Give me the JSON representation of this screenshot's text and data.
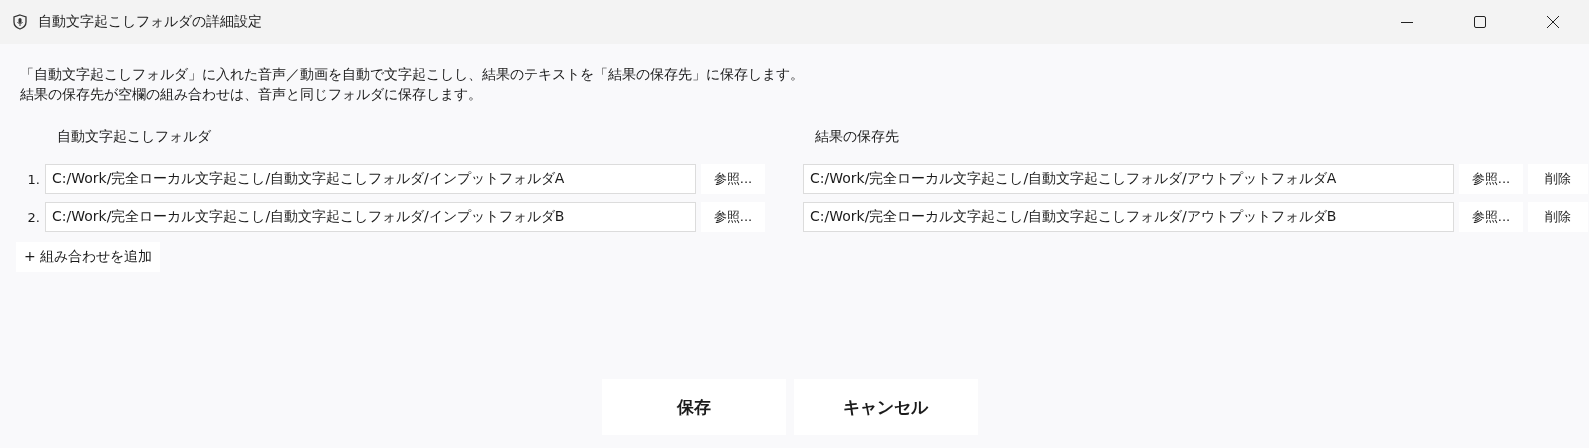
{
  "window": {
    "title": "自動文字起こしフォルダの詳細設定"
  },
  "description": [
    "「自動文字起こしフォルダ」に入れた音声／動画を自動で文字起こしし、結果のテキストを「結果の保存先」に保存します。",
    "結果の保存先が空欄の組み合わせは、音声と同じフォルダに保存します。"
  ],
  "columns": {
    "input": "自動文字起こしフォルダ",
    "output": "結果の保存先"
  },
  "rows": [
    {
      "number": "1.",
      "input": "C:/Work/完全ローカル文字起こし/自動文字起こしフォルダ/インプットフォルダA",
      "input_browse": "参照...",
      "output": "C:/Work/完全ローカル文字起こし/自動文字起こしフォルダ/アウトプットフォルダA",
      "output_browse": "参照...",
      "delete": "削除"
    },
    {
      "number": "2.",
      "input": "C:/Work/完全ローカル文字起こし/自動文字起こしフォルダ/インプットフォルダB",
      "input_browse": "参照...",
      "output": "C:/Work/完全ローカル文字起こし/自動文字起こしフォルダ/アウトプットフォルダB",
      "output_browse": "参照...",
      "delete": "削除"
    }
  ],
  "add_button": "+ 組み合わせを追加",
  "buttons": [
    "保存",
    "キャンセル"
  ]
}
